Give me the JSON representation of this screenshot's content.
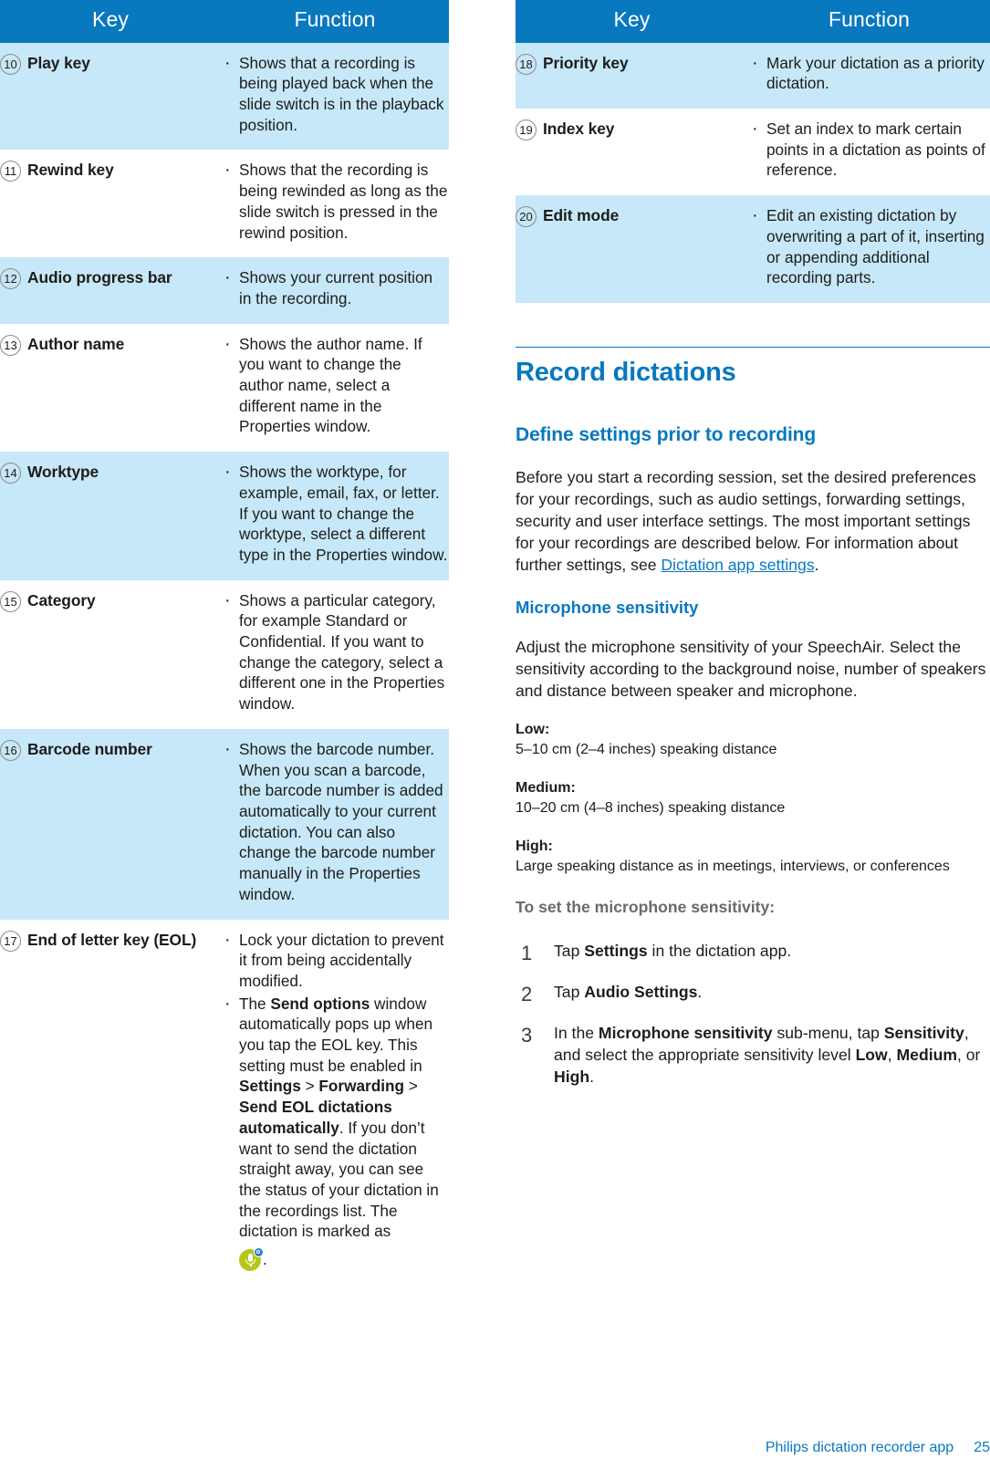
{
  "table_left": {
    "headers": {
      "key": "Key",
      "function": "Function"
    },
    "rows": [
      {
        "num": "10",
        "key": "Play key",
        "shaded": true,
        "items": [
          [
            {
              "t": "Shows that a recording is being played back when the slide switch is in the playback position.",
              "b": false
            }
          ]
        ]
      },
      {
        "num": "11",
        "key": "Rewind key",
        "shaded": false,
        "items": [
          [
            {
              "t": "Shows that the recording is being rewinded as long as the slide switch is pressed in the rewind position.",
              "b": false
            }
          ]
        ]
      },
      {
        "num": "12",
        "key": "Audio progress bar",
        "shaded": true,
        "items": [
          [
            {
              "t": "Shows your current position in the recording.",
              "b": false
            }
          ]
        ]
      },
      {
        "num": "13",
        "key": "Author name",
        "shaded": false,
        "items": [
          [
            {
              "t": "Shows the author name. If you want to change the author name, select a different name in the Properties window.",
              "b": false
            }
          ]
        ]
      },
      {
        "num": "14",
        "key": "Worktype",
        "shaded": true,
        "items": [
          [
            {
              "t": "Shows the worktype, for example, email, fax, or letter. If you want to change the worktype, select a different type in the Properties window.",
              "b": false
            }
          ]
        ]
      },
      {
        "num": "15",
        "key": "Category",
        "shaded": false,
        "items": [
          [
            {
              "t": "Shows a particular category, for example Standard or Confidential. If you want to change the category, select a different one in the Properties window.",
              "b": false
            }
          ]
        ]
      },
      {
        "num": "16",
        "key": "Barcode number",
        "shaded": true,
        "items": [
          [
            {
              "t": "Shows the barcode number. When you scan a barcode, the barcode number is added automatically to your current dictation. You can also change the barcode number manually in the Properties window.",
              "b": false
            }
          ]
        ]
      },
      {
        "num": "17",
        "key": "End of letter key (EOL)",
        "shaded": false,
        "items": [
          [
            {
              "t": "Lock your dictation to prevent it from being accidentally modified.",
              "b": false
            }
          ],
          [
            {
              "t": "The ",
              "b": false
            },
            {
              "t": "Send options",
              "b": true
            },
            {
              "t": " window automatically pops up when you tap the EOL key. This setting must be enabled in ",
              "b": false
            },
            {
              "t": "Settings",
              "b": true
            },
            {
              "t": " > ",
              "b": false
            },
            {
              "t": "Forwarding",
              "b": true
            },
            {
              "t": " > ",
              "b": false
            },
            {
              "t": "Send EOL dictations automatically",
              "b": true
            },
            {
              "t": ". If you don’t want to send the dictation straight away, you can see the status of your dictation in the recordings list. The dictation is marked as ",
              "b": false
            },
            {
              "t": "__ICON__",
              "b": false
            },
            {
              "t": ".",
              "b": false
            }
          ]
        ]
      }
    ]
  },
  "table_right": {
    "headers": {
      "key": "Key",
      "function": "Function"
    },
    "rows": [
      {
        "num": "18",
        "key": "Priority key",
        "shaded": true,
        "items": [
          [
            {
              "t": "Mark your dictation as a priority dictation.",
              "b": false
            }
          ]
        ]
      },
      {
        "num": "19",
        "key": "Index key",
        "shaded": false,
        "items": [
          [
            {
              "t": "Set an index to mark certain points in a dictation as points of reference.",
              "b": false
            }
          ]
        ]
      },
      {
        "num": "20",
        "key": "Edit mode",
        "shaded": true,
        "items": [
          [
            {
              "t": "Edit an existing dictation by overwriting a part of it, inserting or appending additional recording parts.",
              "b": false
            }
          ]
        ]
      }
    ]
  },
  "article": {
    "chapter_title": "Record dictations",
    "section_title": "Define settings prior to recording",
    "intro_before_link": "Before you start a recording session, set the desired preferences for your recordings, such as audio settings, forwarding settings, security and user interface settings. The most important settings for your recordings are described below. For information about further settings, see ",
    "intro_link": "Dictation app settings",
    "intro_after_link": ".",
    "subsection_title": "Microphone sensitivity",
    "sensitivity_intro": "Adjust the microphone sensitivity of your SpeechAir. Select the sensitivity according to the background noise, number of speakers and distance between speaker and microphone.",
    "levels": [
      {
        "label": "Low:",
        "desc": "5–10 cm (2–4 inches) speaking distance"
      },
      {
        "label": "Medium:",
        "desc": "10–20 cm (4–8 inches) speaking distance"
      },
      {
        "label": "High:",
        "desc": "Large speaking distance as in meetings, interviews, or conferences"
      }
    ],
    "instructions_heading": "To set the microphone sensitivity:",
    "steps": [
      {
        "num": "1",
        "parts": [
          {
            "t": "Tap ",
            "b": false
          },
          {
            "t": "Settings",
            "b": true
          },
          {
            "t": " in the dictation app.",
            "b": false
          }
        ]
      },
      {
        "num": "2",
        "parts": [
          {
            "t": "Tap ",
            "b": false
          },
          {
            "t": "Audio Settings",
            "b": true
          },
          {
            "t": ".",
            "b": false
          }
        ]
      },
      {
        "num": "3",
        "parts": [
          {
            "t": "In the ",
            "b": false
          },
          {
            "t": "Microphone sensitivity",
            "b": true
          },
          {
            "t": " sub-menu, tap ",
            "b": false
          },
          {
            "t": "Sensitivity",
            "b": true
          },
          {
            "t": ", and select the appropriate sensitivity level ",
            "b": false
          },
          {
            "t": "Low",
            "b": true
          },
          {
            "t": ", ",
            "b": false
          },
          {
            "t": "Medium",
            "b": true
          },
          {
            "t": ", or ",
            "b": false
          },
          {
            "t": "High",
            "b": true
          },
          {
            "t": ".",
            "b": false
          }
        ]
      }
    ]
  },
  "footer": {
    "title": "Philips dictation recorder app",
    "page": "25"
  },
  "colors": {
    "header_blue": "#0878bf",
    "row_shade": "#c7e8f8",
    "heading_blue": "#0878bf",
    "instruction_gray": "#6a6a6a",
    "status_icon_green": "#b3c819",
    "status_icon_badge_blue": "#2f7fd1"
  }
}
